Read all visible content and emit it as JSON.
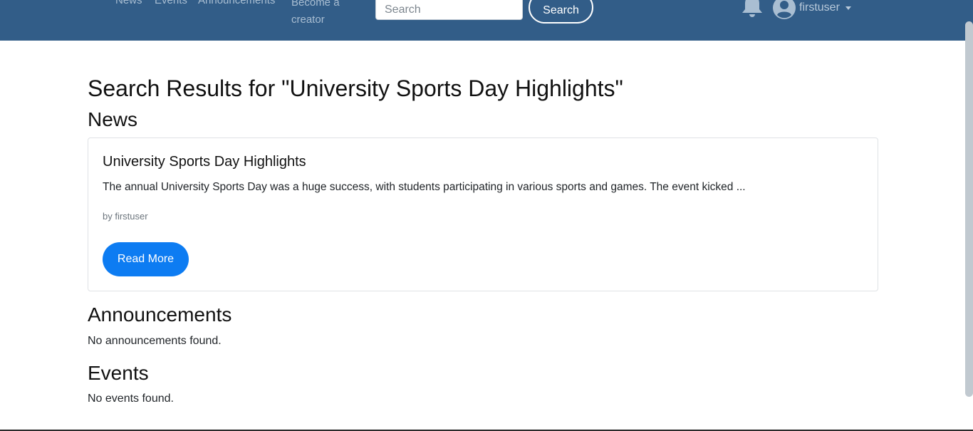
{
  "nav": {
    "links": [
      "News",
      "Events",
      "Announcements",
      "Become a creator"
    ],
    "search": {
      "placeholder": "Search",
      "button_label": "Search"
    },
    "user": {
      "name": "firstuser"
    }
  },
  "page": {
    "title": "Search Results for \"University Sports Day Highlights\""
  },
  "sections": {
    "news": {
      "heading": "News",
      "items": [
        {
          "title": "University Sports Day Highlights",
          "excerpt": "The annual University Sports Day was a huge success, with students participating in various sports and games. The event kicked ...",
          "author": "by firstuser",
          "button_label": "Read More"
        }
      ]
    },
    "announcements": {
      "heading": "Announcements",
      "empty_text": "No announcements found."
    },
    "events": {
      "heading": "Events",
      "empty_text": "No events found."
    }
  },
  "colors": {
    "navbar": "#325d88",
    "primary_button": "#0d7cf2"
  },
  "icons": [
    "bell-icon",
    "user-circle-icon",
    "caret-down-icon"
  ]
}
